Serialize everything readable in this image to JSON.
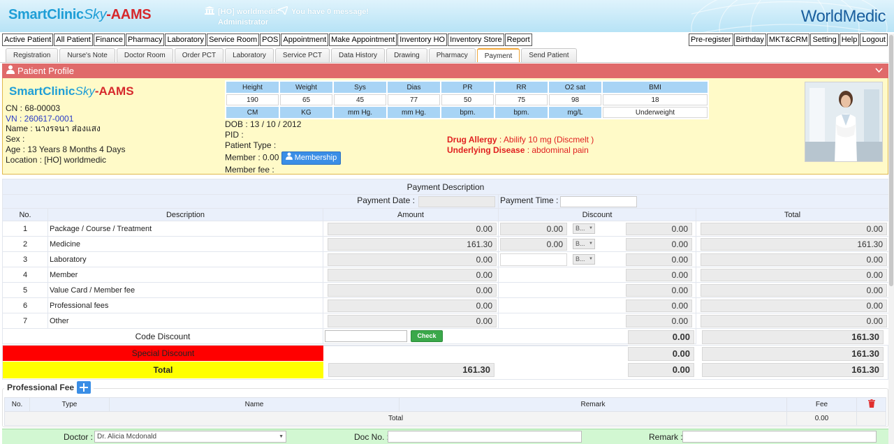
{
  "header": {
    "brand_a": "SmartClinic",
    "brand_b": "Sky",
    "brand_c": "-AAMS",
    "branch": "[HO] worldmedic",
    "user": "Administrator",
    "messages": "You have 0 message!",
    "logo": "WorldMedic"
  },
  "menu": {
    "left": [
      "Active Patient",
      "All Patient",
      "Finance",
      "Pharmacy",
      "Laboratory",
      "Service Room",
      "POS",
      "Appointment",
      "Make Appointment",
      "Inventory HO",
      "Inventory Store",
      "Report"
    ],
    "right": [
      "Pre-register",
      "Birthday",
      "MKT&CRM",
      "Setting",
      "Help",
      "Logout"
    ]
  },
  "tabs": [
    "Registration",
    "Nurse's Note",
    "Doctor Room",
    "Order PCT",
    "Laboratory",
    "Service PCT",
    "Data History",
    "Drawing",
    "Pharmacy",
    "Payment",
    "Send Patient"
  ],
  "active_tab": "Payment",
  "profile": {
    "title": "Patient Profile",
    "cn": "CN : 68-00003",
    "vn": "VN : 260617-0001",
    "name": "Name : นางรจนา ส่องแสง",
    "sex": "Sex :",
    "age": "Age : 13 Years 8 Months 4 Days",
    "location": "Location : [HO] worldmedic",
    "dob": "DOB : 13 / 10 / 2012",
    "pid": "PID :",
    "patient_type": "Patient Type :",
    "member": "Member : 0.00",
    "membership_btn": "Membership",
    "member_fee": "Member fee :",
    "allergy_label": "Drug Allergy",
    "allergy_value": " : Abilify 10 mg (Discmelt )",
    "disease_label": "Underlying Disease",
    "disease_value": " : abdominal pain",
    "vitals": {
      "headers": [
        "Height",
        "Weight",
        "Sys",
        "Dias",
        "PR",
        "RR",
        "O2 sat",
        "BMI"
      ],
      "values": [
        "190",
        "65",
        "45",
        "77",
        "50",
        "75",
        "98",
        "18"
      ],
      "units": [
        "CM",
        "KG",
        "mm Hg.",
        "mm Hg.",
        "bpm.",
        "bpm.",
        "mg/L",
        "Underweight"
      ]
    }
  },
  "payment": {
    "title": "Payment Description",
    "date_label": "Payment Date :",
    "time_label": "Payment Time :",
    "cols": [
      "No.",
      "Description",
      "Amount",
      "Discount",
      "Total"
    ],
    "rows": [
      {
        "no": "1",
        "desc": "Package / Course / Treatment",
        "amount": "0.00",
        "disc": "0.00",
        "sel": "B...",
        "dtotal": "0.00",
        "total": "0.00"
      },
      {
        "no": "2",
        "desc": "Medicine",
        "amount": "161.30",
        "disc": "0.00",
        "sel": "B...",
        "dtotal": "0.00",
        "total": "161.30"
      },
      {
        "no": "3",
        "desc": "Laboratory",
        "amount": "0.00",
        "disc": "",
        "sel": "B...",
        "dtotal": "0.00",
        "total": "0.00"
      },
      {
        "no": "4",
        "desc": "Member",
        "amount": "0.00",
        "dtotal": "0.00",
        "total": "0.00"
      },
      {
        "no": "5",
        "desc": "Value Card / Member fee",
        "amount": "0.00",
        "dtotal": "0.00",
        "total": "0.00"
      },
      {
        "no": "6",
        "desc": "Professional fees",
        "amount": "0.00",
        "dtotal": "0.00",
        "total": "0.00"
      },
      {
        "no": "7",
        "desc": "Other",
        "amount": "0.00",
        "dtotal": "0.00",
        "total": "0.00"
      }
    ],
    "code_discount_label": "Code Discount",
    "check_btn": "Check",
    "code_dtotal": "0.00",
    "code_total": "161.30",
    "special_label": "Special Discount",
    "special_dtotal": "0.00",
    "special_total": "161.30",
    "total_label": "Total",
    "total_amount": "161.30",
    "total_dtotal": "0.00",
    "total_total": "161.30"
  },
  "prof_fee": {
    "title": "Professional Fee",
    "cols": [
      "No.",
      "Type",
      "Name",
      "Remark",
      "Fee"
    ],
    "total_label": "Total",
    "total_value": "0.00"
  },
  "bottom": {
    "doctor_label": "Doctor :",
    "doctor_value": "Dr. Alicia Mcdonald",
    "docno_label": "Doc No. :",
    "remark_label": "Remark :"
  },
  "colors": {
    "profile_bar": "#e06a6a",
    "profile_bg": "#fffac8",
    "special": "#ff0000",
    "total": "#ffff00",
    "accent": "#3a8ee6"
  }
}
